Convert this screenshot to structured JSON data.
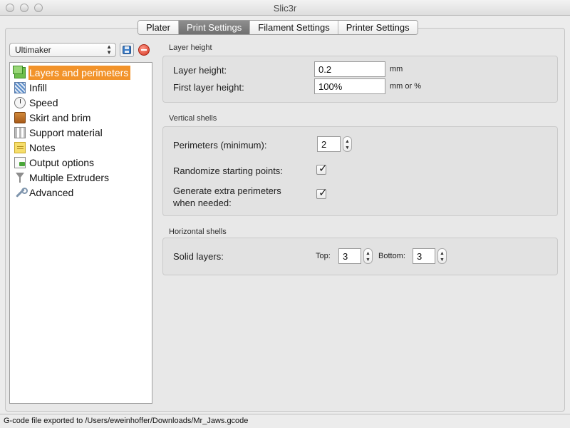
{
  "window": {
    "title": "Slic3r"
  },
  "tabs": [
    {
      "label": "Plater",
      "active": false
    },
    {
      "label": "Print Settings",
      "active": true
    },
    {
      "label": "Filament Settings",
      "active": false
    },
    {
      "label": "Printer Settings",
      "active": false
    }
  ],
  "preset": {
    "selected": "Ultimaker",
    "save_icon": "save-disk-icon",
    "delete_icon": "delete-circle-icon"
  },
  "sidebar": {
    "items": [
      {
        "label": "Layers and perimeters",
        "icon": "layers-icon",
        "selected": true
      },
      {
        "label": "Infill",
        "icon": "infill-icon"
      },
      {
        "label": "Speed",
        "icon": "speed-icon"
      },
      {
        "label": "Skirt and brim",
        "icon": "skirt-icon"
      },
      {
        "label": "Support material",
        "icon": "support-icon"
      },
      {
        "label": "Notes",
        "icon": "notes-icon"
      },
      {
        "label": "Output options",
        "icon": "output-icon"
      },
      {
        "label": "Multiple Extruders",
        "icon": "extruders-icon"
      },
      {
        "label": "Advanced",
        "icon": "wrench-icon"
      }
    ]
  },
  "sections": {
    "layer_height": {
      "title": "Layer height",
      "layer_height_label": "Layer height:",
      "layer_height_value": "0.2",
      "layer_height_unit": "mm",
      "first_layer_label": "First layer height:",
      "first_layer_value": "100%",
      "first_layer_unit": "mm or %"
    },
    "vertical_shells": {
      "title": "Vertical shells",
      "perimeters_label": "Perimeters (minimum):",
      "perimeters_value": "2",
      "randomize_label": "Randomize starting points:",
      "randomize_checked": true,
      "extra_perimeters_label_1": "Generate extra perimeters",
      "extra_perimeters_label_2": "when needed:",
      "extra_perimeters_checked": true
    },
    "horizontal_shells": {
      "title": "Horizontal shells",
      "solid_layers_label": "Solid layers:",
      "top_label": "Top:",
      "top_value": "3",
      "bottom_label": "Bottom:",
      "bottom_value": "3"
    }
  },
  "statusbar": {
    "text": "G-code file exported to /Users/eweinhoffer/Downloads/Mr_Jaws.gcode"
  },
  "colors": {
    "selection": "#f2932a",
    "active_tab": "#7c7c7c"
  }
}
